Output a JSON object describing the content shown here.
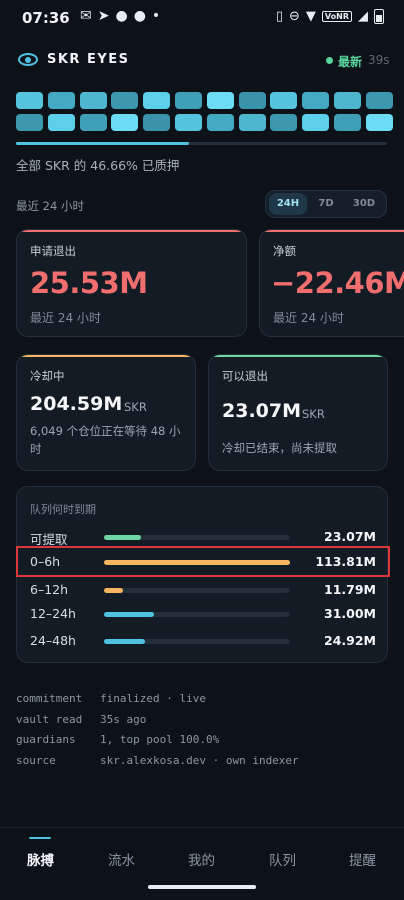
{
  "status": {
    "time": "07:36",
    "network_badge": "VoNR"
  },
  "header": {
    "title": "SKR EYES",
    "live_label": "最新",
    "live_age": "39s"
  },
  "stake_grid": {
    "cells": 24,
    "progress_pct": 46.66
  },
  "staked_text": "全部 SKR 的 46.66% 已质押",
  "period": {
    "label": "最近 24 小时",
    "tabs": [
      "24H",
      "7D",
      "30D"
    ],
    "active": "24H"
  },
  "cards": {
    "unstake": {
      "label": "申请退出",
      "value": "25.53M",
      "sub": "最近 24 小时"
    },
    "net": {
      "label": "净额",
      "value": "−22.46M",
      "sub": "最近 24 小时"
    },
    "cooling": {
      "label": "冷却中",
      "value": "204.59M",
      "unit": "SKR",
      "desc": "6,049 个仓位正在等待 48 小时"
    },
    "withdrawable": {
      "label": "可以退出",
      "value": "23.07M",
      "unit": "SKR",
      "desc": "冷却已结束，尚未提取"
    }
  },
  "queue": {
    "title": "队列何时到期",
    "rows": [
      {
        "label": "可提取",
        "value": "23.07M",
        "fill": 0.2,
        "color": "#6fd6a4"
      },
      {
        "label": "0–6h",
        "value": "113.81M",
        "fill": 1.0,
        "color": "#f5b561"
      },
      {
        "label": "6–12h",
        "value": "11.79M",
        "fill": 0.1,
        "color": "#f5b561"
      },
      {
        "label": "12–24h",
        "value": "31.00M",
        "fill": 0.27,
        "color": "#4fc3df"
      },
      {
        "label": "24–48h",
        "value": "24.92M",
        "fill": 0.22,
        "color": "#4fc3df"
      }
    ]
  },
  "meta": [
    {
      "key": "commitment",
      "value": "finalized · live"
    },
    {
      "key": "vault read",
      "value": "35s ago"
    },
    {
      "key": "guardians",
      "value": "1, top pool 100.0%"
    },
    {
      "key": "source",
      "value": "skr.alexkosa.dev · own indexer"
    }
  ],
  "nav": {
    "items": [
      "脉搏",
      "流水",
      "我的",
      "队列",
      "提醒"
    ],
    "active": "脉搏"
  },
  "colors": {
    "accent": "#4fc3df",
    "negative": "#f06e6e",
    "positive": "#58d39b",
    "warning": "#f5b561",
    "highlight": "#d9393b"
  }
}
